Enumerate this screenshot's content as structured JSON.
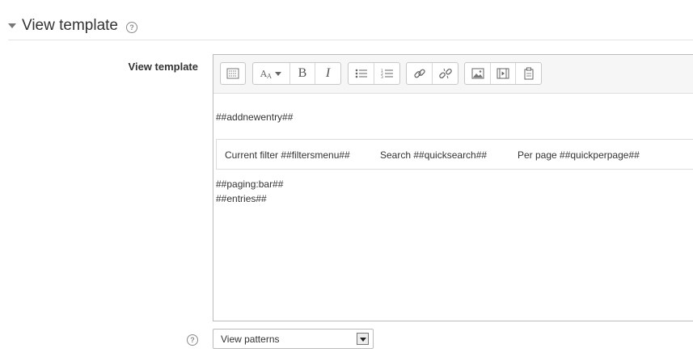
{
  "section": {
    "title": "View template",
    "help_glyph": "?"
  },
  "field": {
    "label": "View template"
  },
  "toolbar": {
    "bold_label": "B",
    "italic_label": "I",
    "icons": [
      "toolbar-toggle-icon",
      "font-style-icon",
      "bold-icon",
      "italic-icon",
      "bullet-list-icon",
      "numbered-list-icon",
      "link-icon",
      "unlink-icon",
      "image-icon",
      "media-icon",
      "manage-files-icon"
    ]
  },
  "template": {
    "line1": "##addnewentry##",
    "filter_items": [
      "Current filter ##filtersmenu##",
      "Search ##quicksearch##",
      "Per page ##quickperpage##"
    ],
    "line2": "##paging:bar##",
    "line3": "##entries##"
  },
  "patterns": {
    "help_glyph": "?",
    "select_value": "View patterns"
  },
  "colors": {
    "toolbar_bg": "#f6f6f6",
    "border": "#bbbbbb",
    "text": "#333333",
    "icon": "#777777"
  }
}
